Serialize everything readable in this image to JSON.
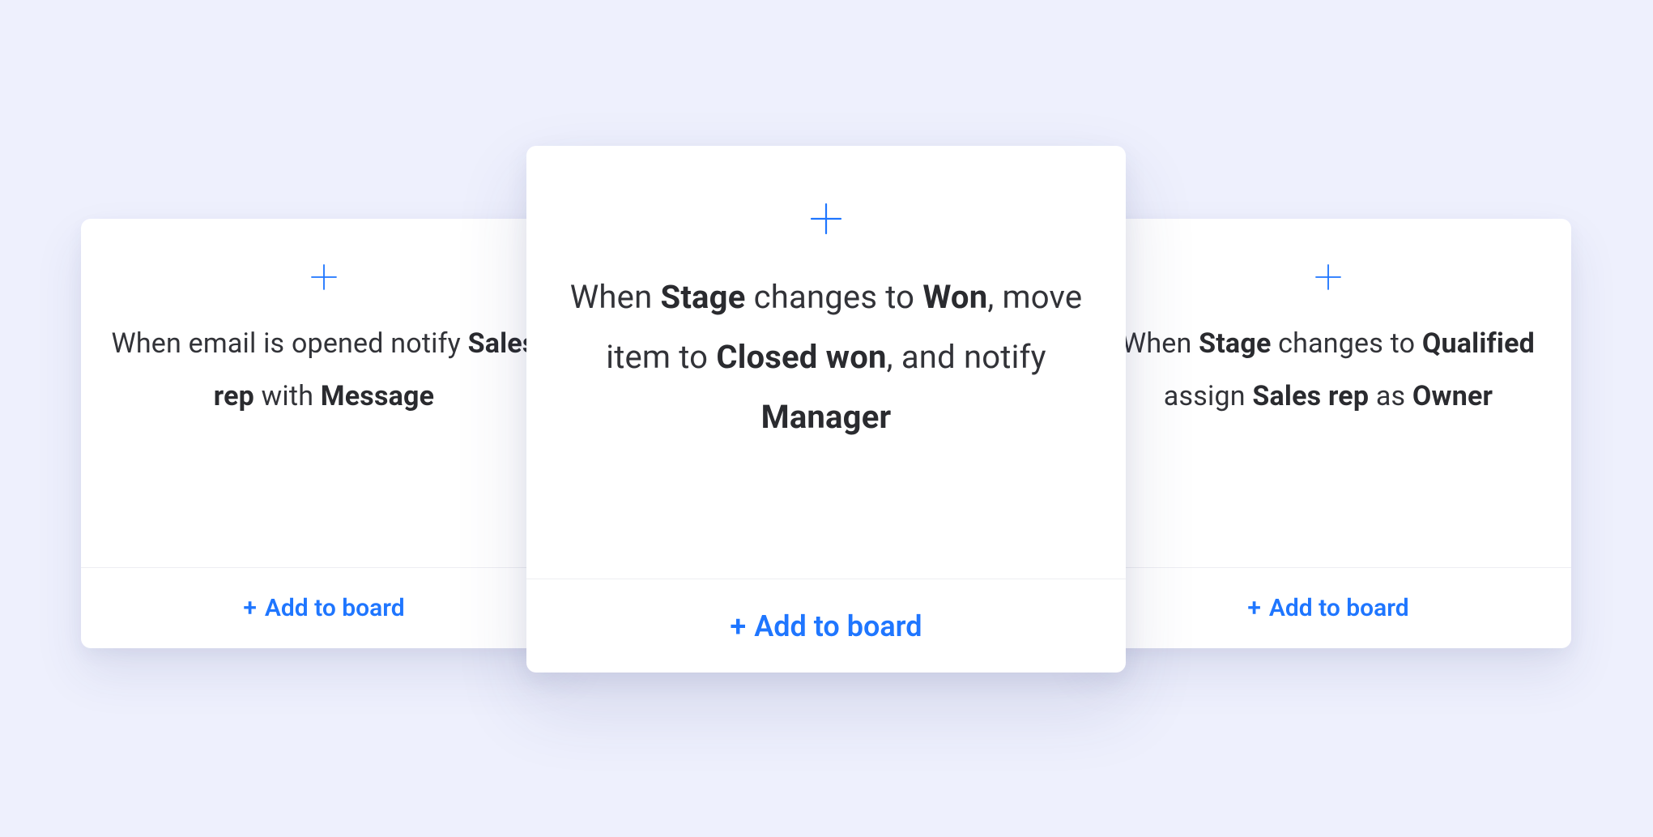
{
  "cards": {
    "left": {
      "desc_segments": [
        {
          "t": "When email is opened notify ",
          "b": false
        },
        {
          "t": "Sales rep",
          "b": true
        },
        {
          "t": " with ",
          "b": false
        },
        {
          "t": "Message",
          "b": true
        }
      ],
      "action_label": "Add to board"
    },
    "center": {
      "desc_segments": [
        {
          "t": "When ",
          "b": false
        },
        {
          "t": "Stage",
          "b": true
        },
        {
          "t": " changes to ",
          "b": false
        },
        {
          "t": "Won",
          "b": true
        },
        {
          "t": ", move item to ",
          "b": false
        },
        {
          "t": "Closed won",
          "b": true
        },
        {
          "t": ", and notify ",
          "b": false
        },
        {
          "t": "Manager",
          "b": true
        }
      ],
      "action_label": "Add to board"
    },
    "right": {
      "desc_segments": [
        {
          "t": "When ",
          "b": false
        },
        {
          "t": "Stage",
          "b": true
        },
        {
          "t": " changes to ",
          "b": false
        },
        {
          "t": "Qualified",
          "b": true
        },
        {
          "t": " assign ",
          "b": false
        },
        {
          "t": "Sales rep",
          "b": true
        },
        {
          "t": " as ",
          "b": false
        },
        {
          "t": "Owner",
          "b": true
        }
      ],
      "action_label": "Add to board"
    }
  },
  "plus_prefix": "+"
}
